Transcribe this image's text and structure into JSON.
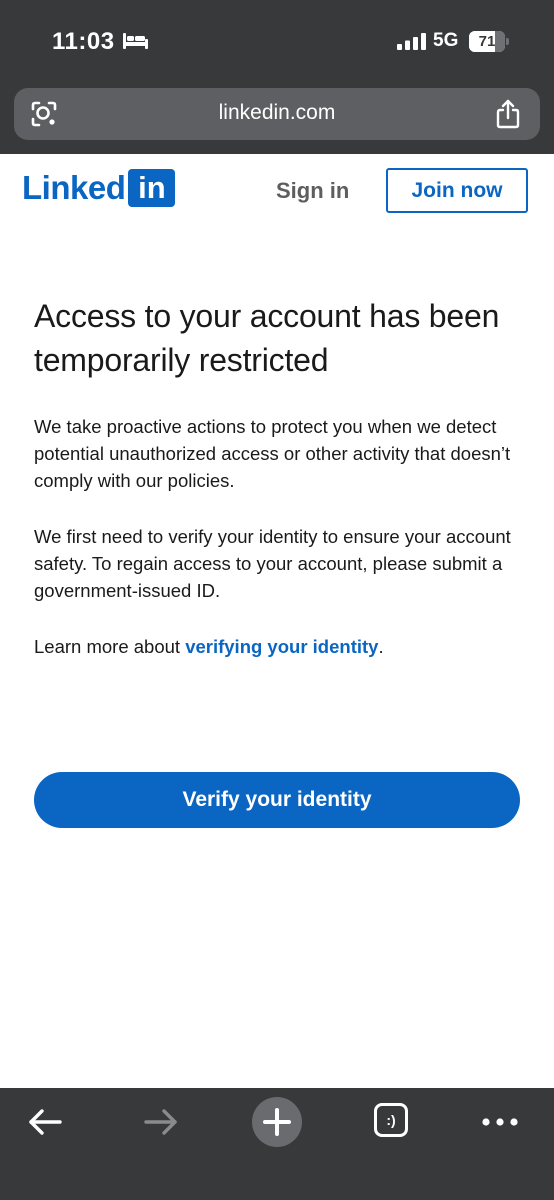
{
  "status_bar": {
    "time": "11:03",
    "network": "5G",
    "battery_level": "71",
    "battery_fraction": 0.71
  },
  "browser": {
    "url": "linkedin.com"
  },
  "header": {
    "logo_word": "Linked",
    "logo_box": "in",
    "sign_in_label": "Sign in",
    "join_now_label": "Join now"
  },
  "main": {
    "heading": "Access to your account has been temporarily restricted",
    "paragraph_1": "We take proactive actions to protect you when we detect potential unauthorized access or other activity that doesn’t comply with our policies.",
    "paragraph_2": "We first need to verify your identity to ensure your account safety. To regain access to your account, please submit a government-issued ID.",
    "learn_more_prefix": "Learn more about ",
    "learn_more_link": "verifying your identity",
    "learn_more_suffix": ".",
    "verify_button_label": "Verify your identity"
  },
  "toolbar": {
    "tabs_glyph": ":)",
    "icons": [
      "back-arrow-icon",
      "forward-arrow-icon",
      "plus-icon",
      "tabs-icon",
      "more-icon"
    ]
  },
  "colors": {
    "brand": "#0a66c2",
    "chrome": "#38393b"
  }
}
